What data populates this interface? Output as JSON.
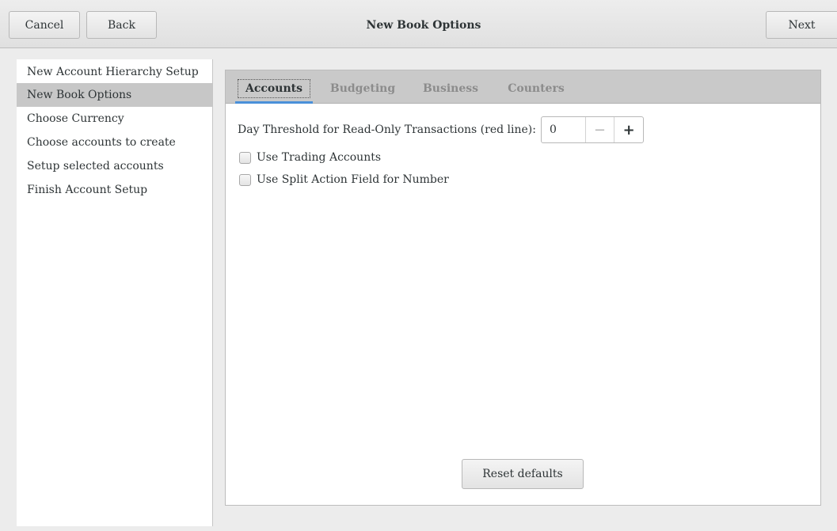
{
  "header": {
    "title": "New Book Options",
    "cancel_label": "Cancel",
    "back_label": "Back",
    "next_label": "Next"
  },
  "sidebar": {
    "items": [
      {
        "label": "New Account Hierarchy Setup"
      },
      {
        "label": "New Book Options"
      },
      {
        "label": "Choose Currency"
      },
      {
        "label": "Choose accounts to create"
      },
      {
        "label": "Setup selected accounts"
      },
      {
        "label": "Finish Account Setup"
      }
    ],
    "selected_index": 1
  },
  "tabs": [
    {
      "label": "Accounts"
    },
    {
      "label": "Budgeting"
    },
    {
      "label": "Business"
    },
    {
      "label": "Counters"
    }
  ],
  "active_tab": 0,
  "accounts": {
    "threshold_label": "Day Threshold for Read-Only Transactions (red line):",
    "threshold_value": "0",
    "minus_glyph": "−",
    "plus_glyph": "+",
    "trading_label": "Use Trading Accounts",
    "trading_checked": false,
    "split_label": "Use Split Action Field for Number",
    "split_checked": false
  },
  "footer": {
    "reset_label": "Reset defaults"
  },
  "colors": {
    "accent": "#4a90d9",
    "selected_row": "#c7c7c7",
    "tabbar": "#c9c9c9"
  },
  "icons": {
    "minus": "minus-icon",
    "plus": "plus-icon"
  }
}
